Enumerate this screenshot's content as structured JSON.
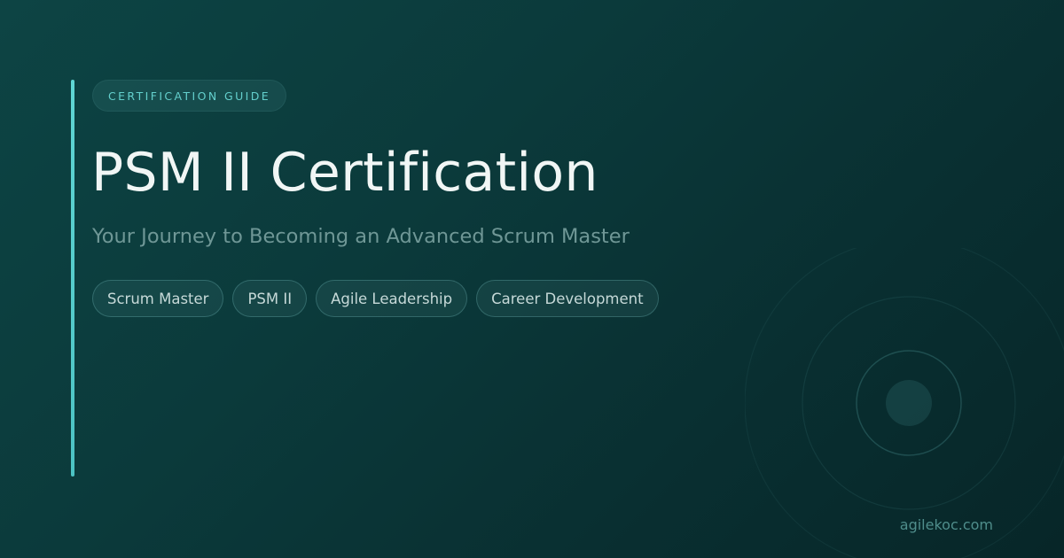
{
  "card": {
    "eyebrow": "CERTIFICATION GUIDE",
    "title": "PSM II Certification",
    "subtitle": "Your Journey to Becoming an Advanced Scrum Master",
    "tags": [
      "Scrum Master",
      "PSM II",
      "Agile Leadership",
      "Career Development"
    ],
    "site": "agilekoc.com"
  },
  "colors": {
    "background": "#0b3a3b",
    "accent": "#5fd6d4",
    "title": "#f1f6f5",
    "subtitle": "#6f9796"
  }
}
